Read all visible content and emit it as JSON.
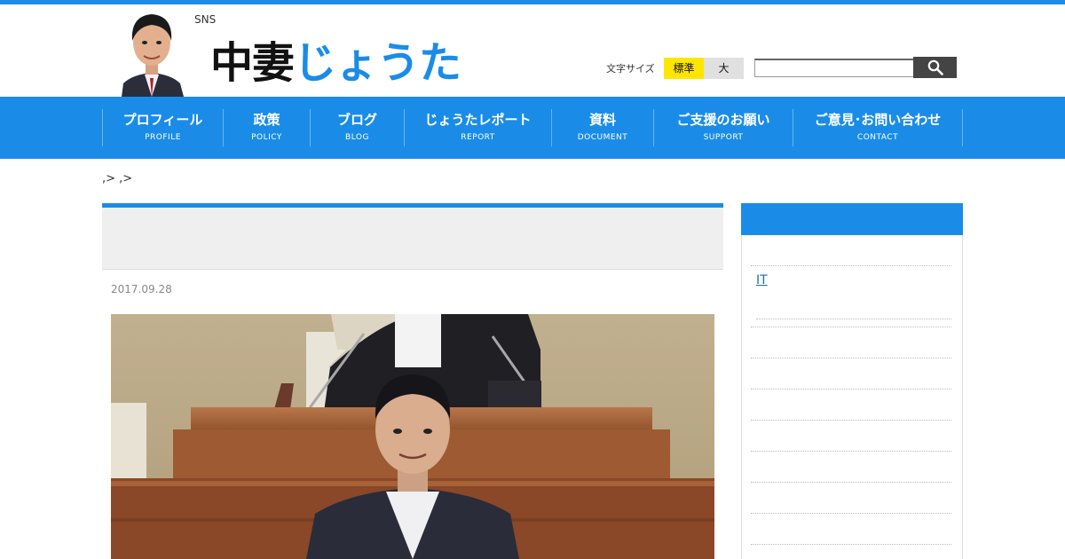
{
  "header": {
    "sns_label": "SNS",
    "logo_part1": "中妻",
    "logo_part2": "じょうた",
    "font_size_label": "文字サイズ",
    "font_size_standard": "標準",
    "font_size_large": "大",
    "search_value": "",
    "search_icon": "search-icon"
  },
  "nav": {
    "items": [
      {
        "ja": "プロフィール",
        "en": "PROFILE"
      },
      {
        "ja": "政策",
        "en": "POLICY"
      },
      {
        "ja": "ブログ",
        "en": "BLOG"
      },
      {
        "ja": "じょうたレポート",
        "en": "REPORT"
      },
      {
        "ja": "資料",
        "en": "DOCUMENT"
      },
      {
        "ja": "ご支援のお願い",
        "en": "SUPPORT"
      },
      {
        "ja": "ご意見･お問い合わせ",
        "en": "CONTACT"
      }
    ]
  },
  "breadcrumb": ",> ,>",
  "article": {
    "date": "2017.09.28"
  },
  "sidebar": {
    "link_it": "IT"
  },
  "colors": {
    "brand_blue": "#1a8ce8",
    "font_btn_active": "#ffe600"
  }
}
